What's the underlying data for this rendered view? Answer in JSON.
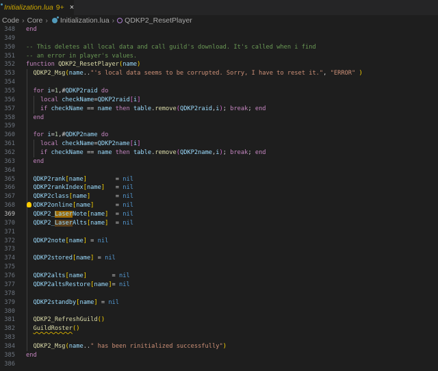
{
  "tab": {
    "label": "Initialization.lua",
    "badge": "9+",
    "close": "×"
  },
  "breadcrumb": [
    "Code",
    "Core",
    "Initialization.lua",
    "QDKP2_ResetPlayer"
  ],
  "colors": {
    "accent": "#cca700",
    "background": "#1e1e1e"
  },
  "code": {
    "current_line": 369,
    "lines": [
      {
        "n": "348",
        "i": 0,
        "t": [
          [
            "end",
            "k"
          ]
        ]
      },
      {
        "n": "349",
        "i": 0,
        "t": []
      },
      {
        "n": "350",
        "i": 0,
        "t": [
          [
            "-- This deletes all local data and call guild's download. It's called when i find",
            "c"
          ]
        ]
      },
      {
        "n": "351",
        "i": 0,
        "t": [
          [
            "-- an error in player's values.",
            "c"
          ]
        ]
      },
      {
        "n": "352",
        "i": 0,
        "t": [
          [
            "function ",
            "k"
          ],
          [
            "QDKP2_ResetPlayer",
            "f"
          ],
          [
            "(",
            "b1"
          ],
          [
            "name",
            "v"
          ],
          [
            ")",
            "b1"
          ]
        ]
      },
      {
        "n": "353",
        "i": 1,
        "t": [
          [
            "QDKP2_Msg",
            "f"
          ],
          [
            "(",
            "b1"
          ],
          [
            "name",
            "v"
          ],
          [
            "..",
            "p"
          ],
          [
            "\"'s local data seems to be corrupted. Sorry, I have to reset it.\"",
            "s"
          ],
          [
            ", ",
            "p"
          ],
          [
            "\"ERROR\"",
            "s"
          ],
          [
            " ",
            "p"
          ],
          [
            ")",
            "b1"
          ]
        ]
      },
      {
        "n": "354",
        "i": 1,
        "t": []
      },
      {
        "n": "355",
        "i": 1,
        "t": [
          [
            "for ",
            "k"
          ],
          [
            "i",
            "v"
          ],
          [
            "=",
            "p"
          ],
          [
            "1",
            "num"
          ],
          [
            ",#",
            "p"
          ],
          [
            "QDKP2raid",
            "v"
          ],
          [
            " do",
            "k"
          ]
        ]
      },
      {
        "n": "356",
        "i": 2,
        "t": [
          [
            "local ",
            "k"
          ],
          [
            "checkName",
            "v"
          ],
          [
            "=",
            "p"
          ],
          [
            "QDKP2raid",
            "v"
          ],
          [
            "[",
            "b2"
          ],
          [
            "i",
            "v"
          ],
          [
            "]",
            "b2"
          ]
        ]
      },
      {
        "n": "357",
        "i": 2,
        "t": [
          [
            "if ",
            "k"
          ],
          [
            "checkName",
            "v"
          ],
          [
            " == ",
            "p"
          ],
          [
            "name",
            "v"
          ],
          [
            " then ",
            "k"
          ],
          [
            "table",
            "v"
          ],
          [
            ".",
            "p"
          ],
          [
            "remove",
            "f"
          ],
          [
            "(",
            "b2"
          ],
          [
            "QDKP2raid",
            "v"
          ],
          [
            ",",
            "p"
          ],
          [
            "i",
            "v"
          ],
          [
            ")",
            "b2"
          ],
          [
            "; ",
            "p"
          ],
          [
            "break",
            "k"
          ],
          [
            "; ",
            "p"
          ],
          [
            "end",
            "k"
          ]
        ]
      },
      {
        "n": "358",
        "i": 1,
        "t": [
          [
            "end",
            "k"
          ]
        ]
      },
      {
        "n": "359",
        "i": 1,
        "t": []
      },
      {
        "n": "360",
        "i": 1,
        "t": [
          [
            "for ",
            "k"
          ],
          [
            "i",
            "v"
          ],
          [
            "=",
            "p"
          ],
          [
            "1",
            "num"
          ],
          [
            ",#",
            "p"
          ],
          [
            "QDKP2name",
            "v"
          ],
          [
            " do",
            "k"
          ]
        ]
      },
      {
        "n": "361",
        "i": 2,
        "t": [
          [
            "local ",
            "k"
          ],
          [
            "checkName",
            "v"
          ],
          [
            "=",
            "p"
          ],
          [
            "QDKP2name",
            "v"
          ],
          [
            "[",
            "b2"
          ],
          [
            "i",
            "v"
          ],
          [
            "]",
            "b2"
          ]
        ]
      },
      {
        "n": "362",
        "i": 2,
        "t": [
          [
            "if ",
            "k"
          ],
          [
            "checkName",
            "v"
          ],
          [
            " == ",
            "p"
          ],
          [
            "name",
            "v"
          ],
          [
            " then ",
            "k"
          ],
          [
            "table",
            "v"
          ],
          [
            ".",
            "p"
          ],
          [
            "remove",
            "f"
          ],
          [
            "(",
            "b2"
          ],
          [
            "QDKP2name",
            "v"
          ],
          [
            ",",
            "p"
          ],
          [
            "i",
            "v"
          ],
          [
            ")",
            "b2"
          ],
          [
            "; ",
            "p"
          ],
          [
            "break",
            "k"
          ],
          [
            "; ",
            "p"
          ],
          [
            "end",
            "k"
          ]
        ]
      },
      {
        "n": "363",
        "i": 1,
        "t": [
          [
            "end",
            "k"
          ]
        ]
      },
      {
        "n": "364",
        "i": 1,
        "t": []
      },
      {
        "n": "365",
        "i": 1,
        "t": [
          [
            "QDKP2rank",
            "v"
          ],
          [
            "[",
            "b1"
          ],
          [
            "name",
            "v"
          ],
          [
            "]",
            "b1"
          ],
          [
            "        = ",
            "p"
          ],
          [
            "nil",
            "n"
          ]
        ]
      },
      {
        "n": "366",
        "i": 1,
        "t": [
          [
            "QDKP2rankIndex",
            "v"
          ],
          [
            "[",
            "b1"
          ],
          [
            "name",
            "v"
          ],
          [
            "]",
            "b1"
          ],
          [
            "   = ",
            "p"
          ],
          [
            "nil",
            "n"
          ]
        ]
      },
      {
        "n": "367",
        "i": 1,
        "t": [
          [
            "QDKP2class",
            "v"
          ],
          [
            "[",
            "b1"
          ],
          [
            "name",
            "v"
          ],
          [
            "]",
            "b1"
          ],
          [
            "       = ",
            "p"
          ],
          [
            "nil",
            "n"
          ]
        ]
      },
      {
        "n": "368",
        "i": 1,
        "bulb": true,
        "t": [
          [
            "QDKP2online",
            "v"
          ],
          [
            "[",
            "b1"
          ],
          [
            "name",
            "v"
          ],
          [
            "]",
            "b1"
          ],
          [
            "      = ",
            "p"
          ],
          [
            "nil",
            "n"
          ]
        ]
      },
      {
        "n": "369",
        "i": 1,
        "t": [
          [
            "QDKP2_",
            "v"
          ],
          [
            "Laser",
            "v hl1"
          ],
          [
            "Note",
            "v"
          ],
          [
            "[",
            "b1"
          ],
          [
            "name",
            "v"
          ],
          [
            "]",
            "b1"
          ],
          [
            "  = ",
            "p"
          ],
          [
            "nil",
            "n"
          ]
        ]
      },
      {
        "n": "370",
        "i": 1,
        "t": [
          [
            "QDKP2_",
            "v"
          ],
          [
            "Laser",
            "v hl2"
          ],
          [
            "Alts",
            "v"
          ],
          [
            "[",
            "b1"
          ],
          [
            "name",
            "v"
          ],
          [
            "]",
            "b1"
          ],
          [
            "  = ",
            "p"
          ],
          [
            "nil",
            "n"
          ]
        ]
      },
      {
        "n": "371",
        "i": 1,
        "t": []
      },
      {
        "n": "372",
        "i": 1,
        "t": [
          [
            "QDKP2note",
            "v"
          ],
          [
            "[",
            "b1"
          ],
          [
            "name",
            "v"
          ],
          [
            "]",
            "b1"
          ],
          [
            " = ",
            "p"
          ],
          [
            "nil",
            "n"
          ]
        ]
      },
      {
        "n": "373",
        "i": 1,
        "t": []
      },
      {
        "n": "374",
        "i": 1,
        "t": [
          [
            "QDKP2stored",
            "v"
          ],
          [
            "[",
            "b1"
          ],
          [
            "name",
            "v"
          ],
          [
            "]",
            "b1"
          ],
          [
            " = ",
            "p"
          ],
          [
            "nil",
            "n"
          ]
        ]
      },
      {
        "n": "375",
        "i": 1,
        "t": []
      },
      {
        "n": "376",
        "i": 1,
        "t": [
          [
            "QDKP2alts",
            "v"
          ],
          [
            "[",
            "b1"
          ],
          [
            "name",
            "v"
          ],
          [
            "]",
            "b1"
          ],
          [
            "       = ",
            "p"
          ],
          [
            "nil",
            "n"
          ]
        ]
      },
      {
        "n": "377",
        "i": 1,
        "t": [
          [
            "QDKP2altsRestore",
            "v"
          ],
          [
            "[",
            "b1"
          ],
          [
            "name",
            "v"
          ],
          [
            "]",
            "b1"
          ],
          [
            "= ",
            "p"
          ],
          [
            "nil",
            "n"
          ]
        ]
      },
      {
        "n": "378",
        "i": 1,
        "t": []
      },
      {
        "n": "379",
        "i": 1,
        "t": [
          [
            "QDKP2standby",
            "v"
          ],
          [
            "[",
            "b1"
          ],
          [
            "name",
            "v"
          ],
          [
            "]",
            "b1"
          ],
          [
            " = ",
            "p"
          ],
          [
            "nil",
            "n"
          ]
        ]
      },
      {
        "n": "380",
        "i": 1,
        "t": []
      },
      {
        "n": "381",
        "i": 1,
        "t": [
          [
            "QDKP2_RefreshGuild",
            "f"
          ],
          [
            "()",
            "b1"
          ]
        ]
      },
      {
        "n": "382",
        "i": 1,
        "t": [
          [
            "GuildRoster",
            "f warn"
          ],
          [
            "()",
            "b1"
          ]
        ]
      },
      {
        "n": "383",
        "i": 1,
        "t": []
      },
      {
        "n": "384",
        "i": 1,
        "t": [
          [
            "QDKP2_Msg",
            "f"
          ],
          [
            "(",
            "b1"
          ],
          [
            "name",
            "v"
          ],
          [
            "..",
            "p"
          ],
          [
            "\" has been rinitialized successfully\"",
            "s"
          ],
          [
            ")",
            "b1"
          ]
        ]
      },
      {
        "n": "385",
        "i": 0,
        "t": [
          [
            "end",
            "k"
          ]
        ]
      },
      {
        "n": "386",
        "i": 0,
        "t": []
      }
    ]
  }
}
